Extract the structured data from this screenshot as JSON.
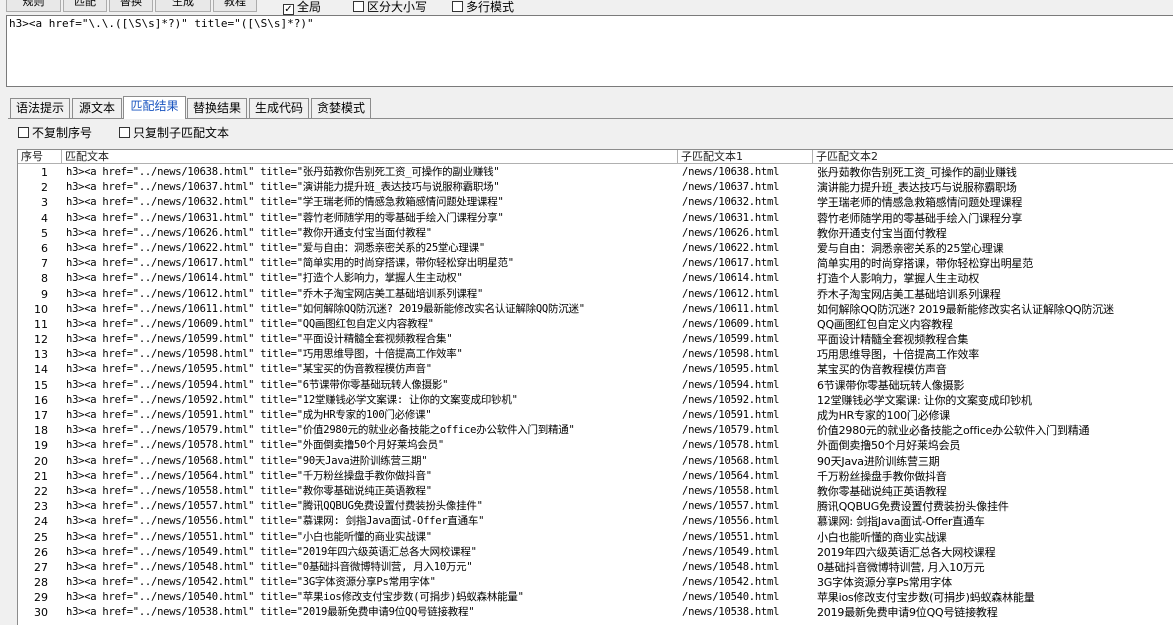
{
  "toolbar": {
    "buttons": [
      "规则",
      "匹配",
      "替换",
      "生成",
      "教程"
    ],
    "global": {
      "label": "全局",
      "checked": true
    },
    "case": {
      "label": "区分大小写",
      "checked": false
    },
    "multiline": {
      "label": "多行模式",
      "checked": false
    }
  },
  "pattern": "h3><a href=\"\\.\\.([\\S\\s]*?)\" title=\"([\\S\\s]*?)\"",
  "tabs": [
    "语法提示",
    "源文本",
    "匹配结果",
    "替换结果",
    "生成代码",
    "贪婪模式"
  ],
  "active_tab": 2,
  "options": {
    "no_copy_seq": "不复制序号",
    "only_copy_sub": "只复制子匹配文本"
  },
  "grid": {
    "headers": [
      "序号",
      "匹配文本",
      "子匹配文本1",
      "子匹配文本2"
    ],
    "rows": [
      {
        "n": "1",
        "m": "h3><a href=\"../news/10638.html\" title=\"张丹茹教你告别死工资_可操作的副业赚钱\"",
        "s1": "/news/10638.html",
        "s2": "张丹茹教你告别死工资_可操作的副业赚钱"
      },
      {
        "n": "2",
        "m": "h3><a href=\"../news/10637.html\" title=\"演讲能力提升班_表达技巧与说服称霸职场\"",
        "s1": "/news/10637.html",
        "s2": "演讲能力提升班_表达技巧与说服称霸职场"
      },
      {
        "n": "3",
        "m": "h3><a href=\"../news/10632.html\" title=\"学王瑞老师的情感急救箱感情问题处理课程\"",
        "s1": "/news/10632.html",
        "s2": "学王瑞老师的情感急救箱感情问题处理课程"
      },
      {
        "n": "4",
        "m": "h3><a href=\"../news/10631.html\" title=\"蓉竹老师随学用的零基础手绘入门课程分享\"",
        "s1": "/news/10631.html",
        "s2": "蓉竹老师随学用的零基础手绘入门课程分享"
      },
      {
        "n": "5",
        "m": "h3><a href=\"../news/10626.html\" title=\"教你开通支付宝当面付教程\"",
        "s1": "/news/10626.html",
        "s2": "教你开通支付宝当面付教程"
      },
      {
        "n": "6",
        "m": "h3><a href=\"../news/10622.html\" title=\"爱与自由：洞悉亲密关系的25堂心理课\"",
        "s1": "/news/10622.html",
        "s2": "爱与自由：洞悉亲密关系的25堂心理课"
      },
      {
        "n": "7",
        "m": "h3><a href=\"../news/10617.html\" title=\"简单实用的时尚穿搭课，带你轻松穿出明星范\"",
        "s1": "/news/10617.html",
        "s2": "简单实用的时尚穿搭课，带你轻松穿出明星范"
      },
      {
        "n": "8",
        "m": "h3><a href=\"../news/10614.html\" title=\"打造个人影响力，掌握人生主动权\"",
        "s1": "/news/10614.html",
        "s2": "打造个人影响力，掌握人生主动权"
      },
      {
        "n": "9",
        "m": "h3><a href=\"../news/10612.html\" title=\"乔木子淘宝网店美工基础培训系列课程\"",
        "s1": "/news/10612.html",
        "s2": "乔木子淘宝网店美工基础培训系列课程"
      },
      {
        "n": "10",
        "m": "h3><a href=\"../news/10611.html\" title=\"如何解除QQ防沉迷? 2019最新能修改实名认证解除QQ防沉迷\"",
        "s1": "/news/10611.html",
        "s2": "如何解除QQ防沉迷? 2019最新能修改实名认证解除QQ防沉迷"
      },
      {
        "n": "11",
        "m": "h3><a href=\"../news/10609.html\" title=\"QQ画图红包自定义内容教程\"",
        "s1": "/news/10609.html",
        "s2": "QQ画图红包自定义内容教程"
      },
      {
        "n": "12",
        "m": "h3><a href=\"../news/10599.html\" title=\"平面设计精髓全套视频教程合集\"",
        "s1": "/news/10599.html",
        "s2": "平面设计精髓全套视频教程合集"
      },
      {
        "n": "13",
        "m": "h3><a href=\"../news/10598.html\" title=\"巧用思维导图，十倍提高工作效率\"",
        "s1": "/news/10598.html",
        "s2": "巧用思维导图，十倍提高工作效率"
      },
      {
        "n": "14",
        "m": "h3><a href=\"../news/10595.html\" title=\"某宝买的伪音教程模仿声音\"",
        "s1": "/news/10595.html",
        "s2": "某宝买的伪音教程模仿声音"
      },
      {
        "n": "15",
        "m": "h3><a href=\"../news/10594.html\" title=\"6节课带你零基础玩转人像摄影\"",
        "s1": "/news/10594.html",
        "s2": "6节课带你零基础玩转人像摄影"
      },
      {
        "n": "16",
        "m": "h3><a href=\"../news/10592.html\" title=\"12堂赚钱必学文案课: 让你的文案变成印钞机\"",
        "s1": "/news/10592.html",
        "s2": "12堂赚钱必学文案课: 让你的文案变成印钞机"
      },
      {
        "n": "17",
        "m": "h3><a href=\"../news/10591.html\" title=\"成为HR专家的100门必修课\"",
        "s1": "/news/10591.html",
        "s2": "成为HR专家的100门必修课"
      },
      {
        "n": "18",
        "m": "h3><a href=\"../news/10579.html\" title=\"价值2980元的就业必备技能之office办公软件入门到精通\"",
        "s1": "/news/10579.html",
        "s2": "价值2980元的就业必备技能之office办公软件入门到精通"
      },
      {
        "n": "19",
        "m": "h3><a href=\"../news/10578.html\" title=\"外面倒卖撸50个月好莱坞会员\"",
        "s1": "/news/10578.html",
        "s2": "外面倒卖撸50个月好莱坞会员"
      },
      {
        "n": "20",
        "m": "h3><a href=\"../news/10568.html\" title=\"90天Java进阶训练营三期\"",
        "s1": "/news/10568.html",
        "s2": "90天Java进阶训练营三期"
      },
      {
        "n": "21",
        "m": "h3><a href=\"../news/10564.html\" title=\"千万粉丝操盘手教你做抖音\"",
        "s1": "/news/10564.html",
        "s2": "千万粉丝操盘手教你做抖音"
      },
      {
        "n": "22",
        "m": "h3><a href=\"../news/10558.html\" title=\"教你零基础说纯正英语教程\"",
        "s1": "/news/10558.html",
        "s2": "教你零基础说纯正英语教程"
      },
      {
        "n": "23",
        "m": "h3><a href=\"../news/10557.html\" title=\"腾讯QQBUG免费设置付费装扮头像挂件\"",
        "s1": "/news/10557.html",
        "s2": "腾讯QQBUG免费设置付费装扮头像挂件"
      },
      {
        "n": "24",
        "m": "h3><a href=\"../news/10556.html\" title=\"慕课网: 剑指Java面试-Offer直通车\"",
        "s1": "/news/10556.html",
        "s2": "慕课网: 剑指Java面试-Offer直通车"
      },
      {
        "n": "25",
        "m": "h3><a href=\"../news/10551.html\" title=\"小白也能听懂的商业实战课\"",
        "s1": "/news/10551.html",
        "s2": "小白也能听懂的商业实战课"
      },
      {
        "n": "26",
        "m": "h3><a href=\"../news/10549.html\" title=\"2019年四六级英语汇总各大网校课程\"",
        "s1": "/news/10549.html",
        "s2": "2019年四六级英语汇总各大网校课程"
      },
      {
        "n": "27",
        "m": "h3><a href=\"../news/10548.html\" title=\"0基础抖音微博特训营, 月入10万元\"",
        "s1": "/news/10548.html",
        "s2": "0基础抖音微博特训营, 月入10万元"
      },
      {
        "n": "28",
        "m": "h3><a href=\"../news/10542.html\" title=\"3G字体资源分享Ps常用字体\"",
        "s1": "/news/10542.html",
        "s2": "3G字体资源分享Ps常用字体"
      },
      {
        "n": "29",
        "m": "h3><a href=\"../news/10540.html\" title=\"苹果ios修改支付宝步数(可捐步)蚂蚁森林能量\"",
        "s1": "/news/10540.html",
        "s2": "苹果ios修改支付宝步数(可捐步)蚂蚁森林能量"
      },
      {
        "n": "30",
        "m": "h3><a href=\"../news/10538.html\" title=\"2019最新免费申请9位QQ号链接教程\"",
        "s1": "/news/10538.html",
        "s2": "2019最新免费申请9位QQ号链接教程"
      }
    ]
  }
}
